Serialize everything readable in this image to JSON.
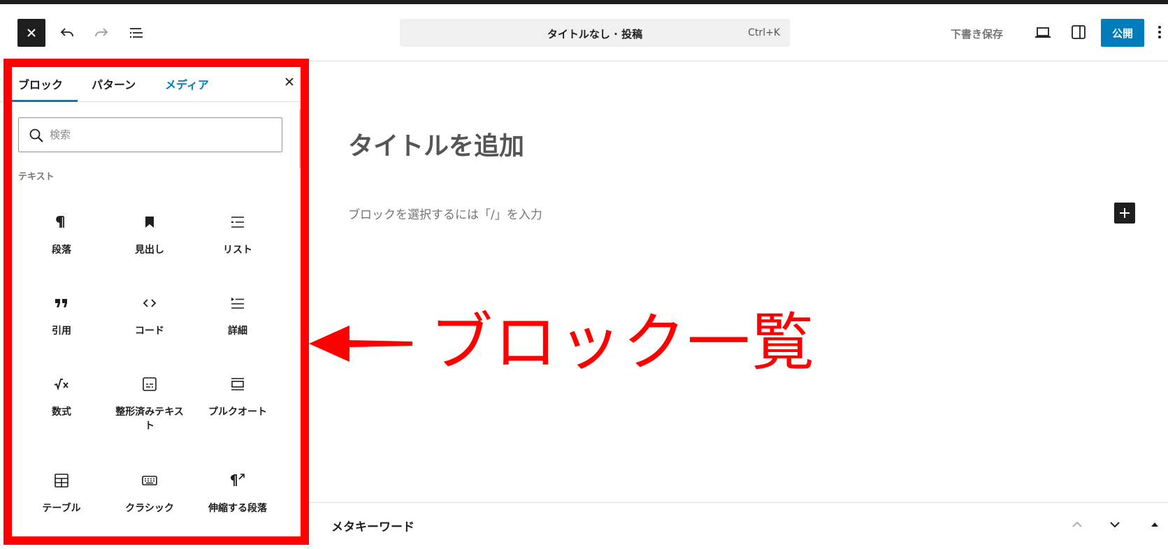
{
  "header": {
    "doc_title": "タイトルなし · 投稿",
    "shortcut": "Ctrl+K",
    "save_draft": "下書き保存",
    "publish": "公開"
  },
  "inserter": {
    "tabs": [
      {
        "label": "ブロック"
      },
      {
        "label": "パターン"
      },
      {
        "label": "メディア"
      }
    ],
    "search_placeholder": "検索",
    "category": "テキスト",
    "blocks": [
      {
        "label": "段落",
        "icon": "paragraph-icon"
      },
      {
        "label": "見出し",
        "icon": "heading-icon"
      },
      {
        "label": "リスト",
        "icon": "list-icon"
      },
      {
        "label": "引用",
        "icon": "quote-icon"
      },
      {
        "label": "コード",
        "icon": "code-icon"
      },
      {
        "label": "詳細",
        "icon": "details-icon"
      },
      {
        "label": "数式",
        "icon": "math-icon"
      },
      {
        "label": "整形済みテキスト",
        "icon": "preformatted-icon"
      },
      {
        "label": "プルクオート",
        "icon": "pullquote-icon"
      },
      {
        "label": "テーブル",
        "icon": "table-icon"
      },
      {
        "label": "クラシック",
        "icon": "keyboard-icon"
      },
      {
        "label": "伸縮する段落",
        "icon": "fit-text-icon"
      }
    ]
  },
  "editor": {
    "title_placeholder": "タイトルを追加",
    "block_hint": "ブロックを選択するには「/」を入力"
  },
  "annotation": {
    "text": "ブロック一覧",
    "color": "#ff0000"
  },
  "metabox": {
    "title": "メタキーワード"
  },
  "colors": {
    "accent": "#007cba",
    "dark": "#1e1e1e"
  }
}
